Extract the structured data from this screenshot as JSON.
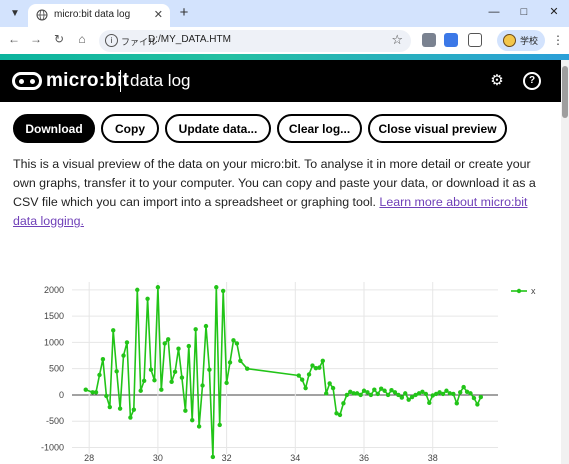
{
  "browser": {
    "tab_title": "micro:bit data log",
    "url_scheme": "ファイル",
    "url": "D:/MY_DATA.HTM",
    "profile_label": "学校",
    "icons": [
      "menu-icon",
      "globe-icon",
      "close-icon",
      "plus-icon",
      "minimize-icon",
      "maximize-icon",
      "back-icon",
      "forward-icon",
      "reload-icon",
      "home-icon",
      "info-icon",
      "star-icon",
      "extension-icon",
      "translate-icon",
      "puzzle-icon",
      "kebab-menu-icon"
    ]
  },
  "header": {
    "brand": "micro:bit",
    "title": "data log",
    "icons": [
      "settings-icon",
      "help-icon"
    ]
  },
  "actions": {
    "download": "Download",
    "copy": "Copy",
    "update": "Update data...",
    "clear": "Clear log...",
    "close_preview": "Close visual preview"
  },
  "description": {
    "text": "This is a visual preview of the data on your micro:bit. To analyse it in more detail or create your own graphs, transfer it to your computer. You can copy and paste your data, or download it as a CSV file which you can import into a spreadsheet or graphing tool. ",
    "link": "Learn more about micro:bit data logging."
  },
  "colors": {
    "accent": "#0bb39d",
    "series": "#22c418",
    "header_bg": "#000000",
    "link": "#6f3fb8"
  },
  "chart_data": {
    "type": "line",
    "legend_position": "top-right",
    "grid": true,
    "xlim": [
      27.5,
      39.9
    ],
    "ylim": [
      -1200,
      2150
    ],
    "x_ticks": [
      28,
      30,
      32,
      34,
      36,
      38
    ],
    "y_ticks": [
      2000,
      1500,
      1000,
      500,
      0,
      -500,
      -1000
    ],
    "series": [
      {
        "name": "x",
        "x": [
          27.9,
          28.1,
          28.2,
          28.3,
          28.4,
          28.5,
          28.6,
          28.7,
          28.8,
          28.9,
          29.0,
          29.1,
          29.2,
          29.3,
          29.4,
          29.5,
          29.6,
          29.7,
          29.8,
          29.9,
          30.0,
          30.1,
          30.2,
          30.3,
          30.4,
          30.5,
          30.6,
          30.7,
          30.8,
          30.9,
          31.0,
          31.1,
          31.2,
          31.3,
          31.4,
          31.5,
          31.6,
          31.7,
          31.8,
          31.9,
          32.0,
          32.1,
          32.2,
          32.3,
          32.4,
          32.6,
          34.1,
          34.2,
          34.3,
          34.4,
          34.5,
          34.6,
          34.7,
          34.8,
          34.9,
          35.0,
          35.1,
          35.2,
          35.3,
          35.4,
          35.5,
          35.6,
          35.7,
          35.8,
          35.9,
          36.0,
          36.1,
          36.2,
          36.3,
          36.4,
          36.5,
          36.6,
          36.7,
          36.8,
          36.9,
          37.0,
          37.1,
          37.2,
          37.3,
          37.4,
          37.5,
          37.6,
          37.7,
          37.8,
          37.9,
          38.0,
          38.1,
          38.2,
          38.3,
          38.4,
          38.5,
          38.6,
          38.7,
          38.8,
          38.9,
          39.0,
          39.1,
          39.2,
          39.3,
          39.4
        ],
        "y": [
          100,
          50,
          50,
          380,
          680,
          -20,
          -230,
          1230,
          450,
          -260,
          750,
          1000,
          -430,
          -280,
          2000,
          80,
          270,
          1830,
          480,
          280,
          2050,
          100,
          980,
          1060,
          250,
          440,
          880,
          330,
          -300,
          930,
          -480,
          1250,
          -600,
          180,
          1310,
          480,
          -1180,
          2050,
          -570,
          1980,
          230,
          620,
          1040,
          980,
          650,
          500,
          370,
          290,
          130,
          390,
          560,
          510,
          520,
          650,
          30,
          220,
          130,
          -350,
          -380,
          -160,
          0,
          60,
          30,
          30,
          0,
          80,
          50,
          0,
          100,
          20,
          120,
          80,
          0,
          90,
          50,
          0,
          -50,
          30,
          -90,
          -40,
          0,
          30,
          60,
          20,
          -150,
          -10,
          20,
          50,
          20,
          80,
          30,
          20,
          -160,
          50,
          150,
          60,
          30,
          -60,
          -180,
          -40
        ]
      }
    ]
  }
}
